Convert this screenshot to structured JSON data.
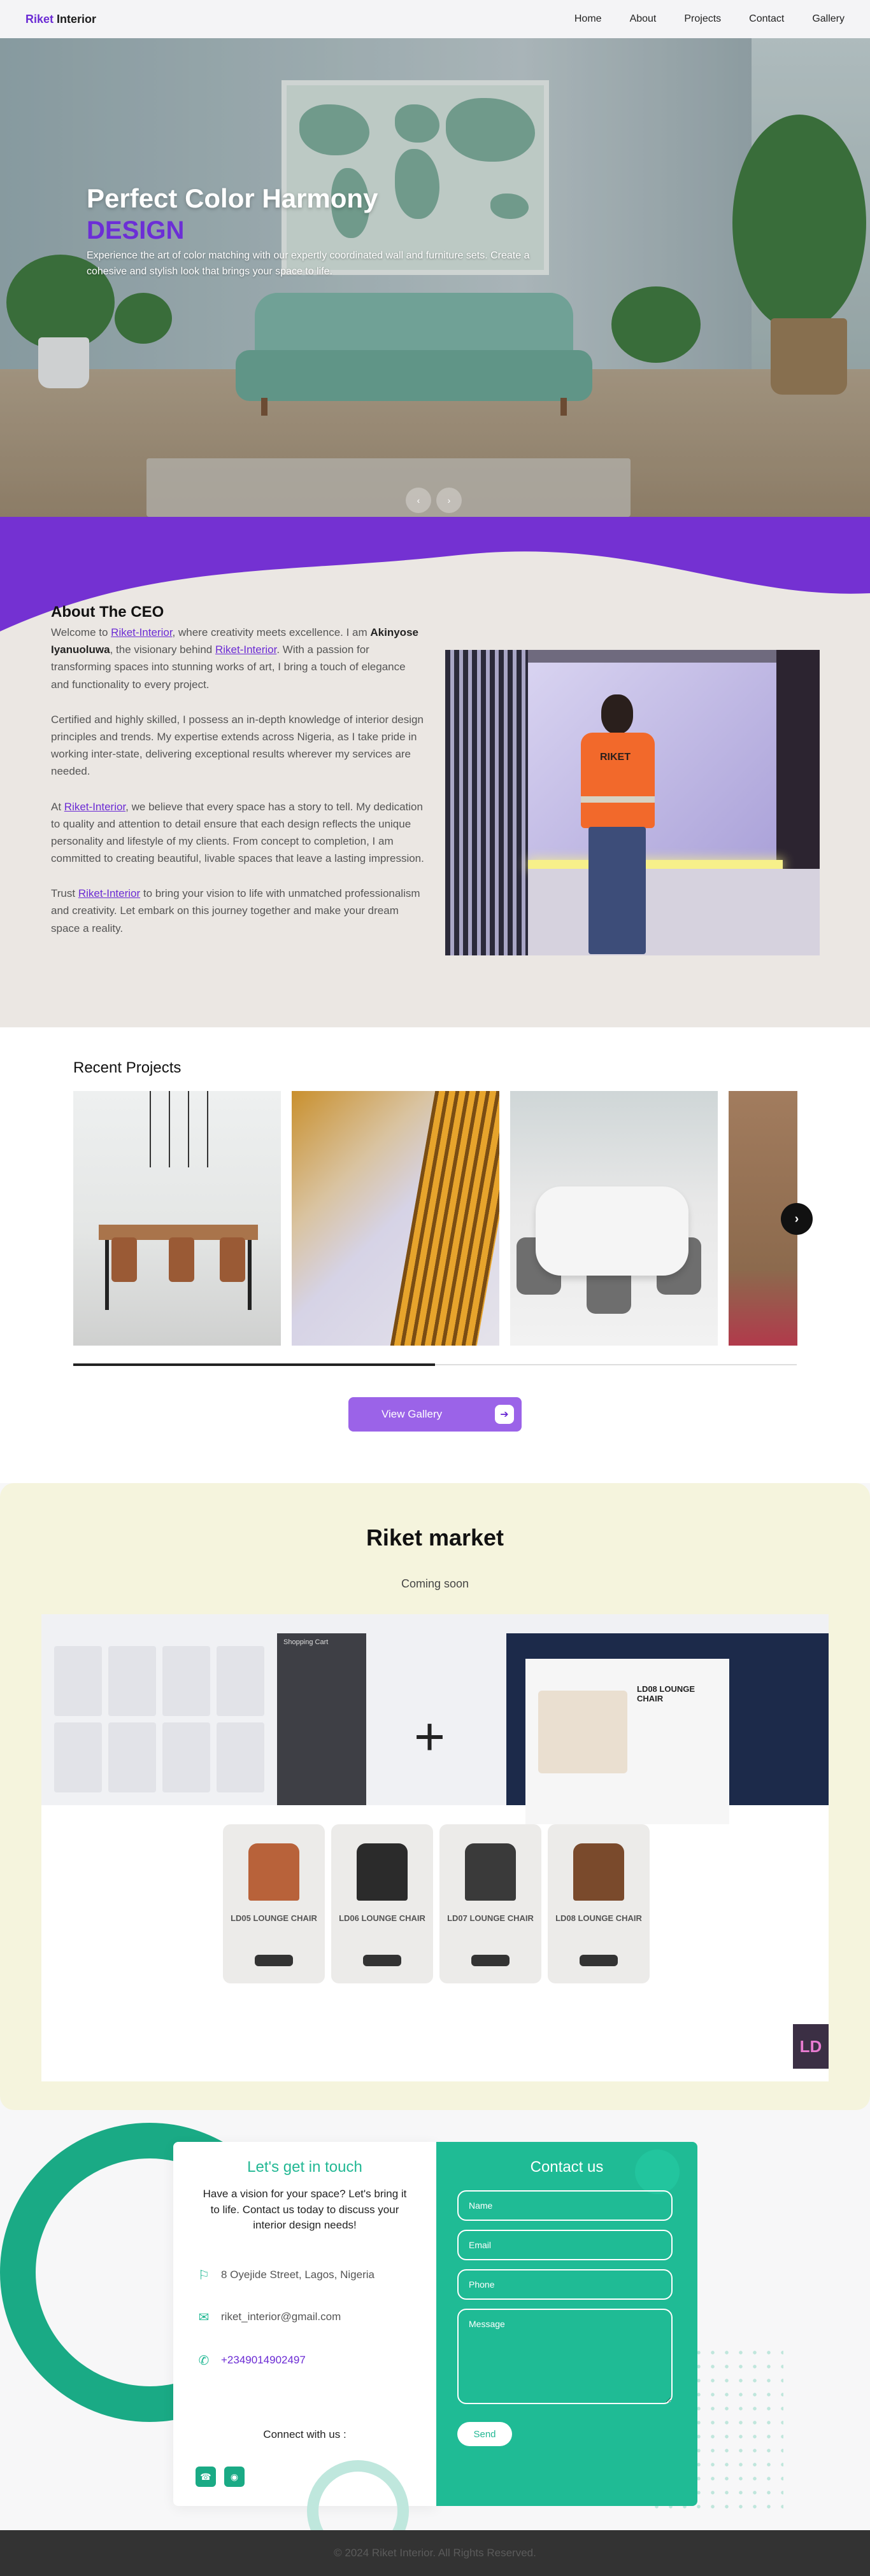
{
  "nav": {
    "brand_part1": "Riket",
    "brand_part2": "Interior",
    "links": [
      "Home",
      "About",
      "Projects",
      "Contact",
      "Gallery"
    ]
  },
  "hero": {
    "title": "Perfect Color Harmony",
    "subtitle": "DESIGN",
    "text": "Experience the art of color matching with our expertly coordinated wall and furniture sets. Create a cohesive and stylish look that brings your space to life.",
    "prev_icon": "chevron-left-icon",
    "next_icon": "chevron-right-icon"
  },
  "about": {
    "heading": "About The CEO",
    "p1_a": "Welcome to ",
    "p1_link1": "Riket-Interior",
    "p1_b": ", where creativity meets excellence. I am ",
    "p1_name": "Akinyose Iyanuoluwa",
    "p1_c": ", the visionary behind ",
    "p1_link2": "Riket-Interior",
    "p1_d": ". With a passion for transforming spaces into stunning works of art, I bring a touch of elegance and functionality to every project.",
    "p2": "Certified and highly skilled, I possess an in-depth knowledge of interior design principles and trends. My expertise extends across Nigeria, as I take pride in working inter-state, delivering exceptional results wherever my services are needed.",
    "p3_a": "At ",
    "p3_link": "Riket-Interior",
    "p3_b": ", we believe that every space has a story to tell. My dedication to quality and attention to detail ensure that each design reflects the unique personality and lifestyle of my clients. From concept to completion, I am committed to creating beautiful, livable spaces that leave a lasting impression.",
    "p4_a": "Trust ",
    "p4_link": "Riket-Interior",
    "p4_b": " to bring your vision to life with unmatched professionalism and creativity. Let embark on this journey together and make your dream space a reality.",
    "vest_text": "RIKET"
  },
  "projects": {
    "heading": "Recent Projects",
    "gallery_button": "View Gallery",
    "scroll_progress": 0.5
  },
  "market": {
    "heading": "Riket market",
    "status": "Coming soon",
    "product_labels": [
      "LD05 LOUNGE CHAIR",
      "LD06 LOUNGE CHAIR",
      "LD07 LOUNGE CHAIR",
      "LD08 LOUNGE CHAIR"
    ],
    "detail_title": "LD08 LOUNGE CHAIR",
    "cart_title": "Shopping Cart",
    "logo_text": "LD"
  },
  "contact": {
    "left_heading": "Let's get in touch",
    "intro": "Have a vision for your space? Let's bring it to life. Contact us today to discuss your interior design needs!",
    "address": "8 Oyejide Street, Lagos, Nigeria",
    "email": "riket_interior@gmail.com",
    "phone": "+2349014902497",
    "connect": "Connect with us :",
    "right_heading": "Contact us",
    "placeholders": {
      "name": "Name",
      "email": "Email",
      "phone": "Phone",
      "message": "Message"
    },
    "send": "Send"
  },
  "footer": {
    "text": "© 2024 Riket Interior. All Rights Reserved."
  },
  "colors": {
    "brand_purple": "#6b2bd4",
    "accent_green": "#1fbb95",
    "market_bg": "#f5f4dd",
    "footer_bg": "#333333"
  }
}
